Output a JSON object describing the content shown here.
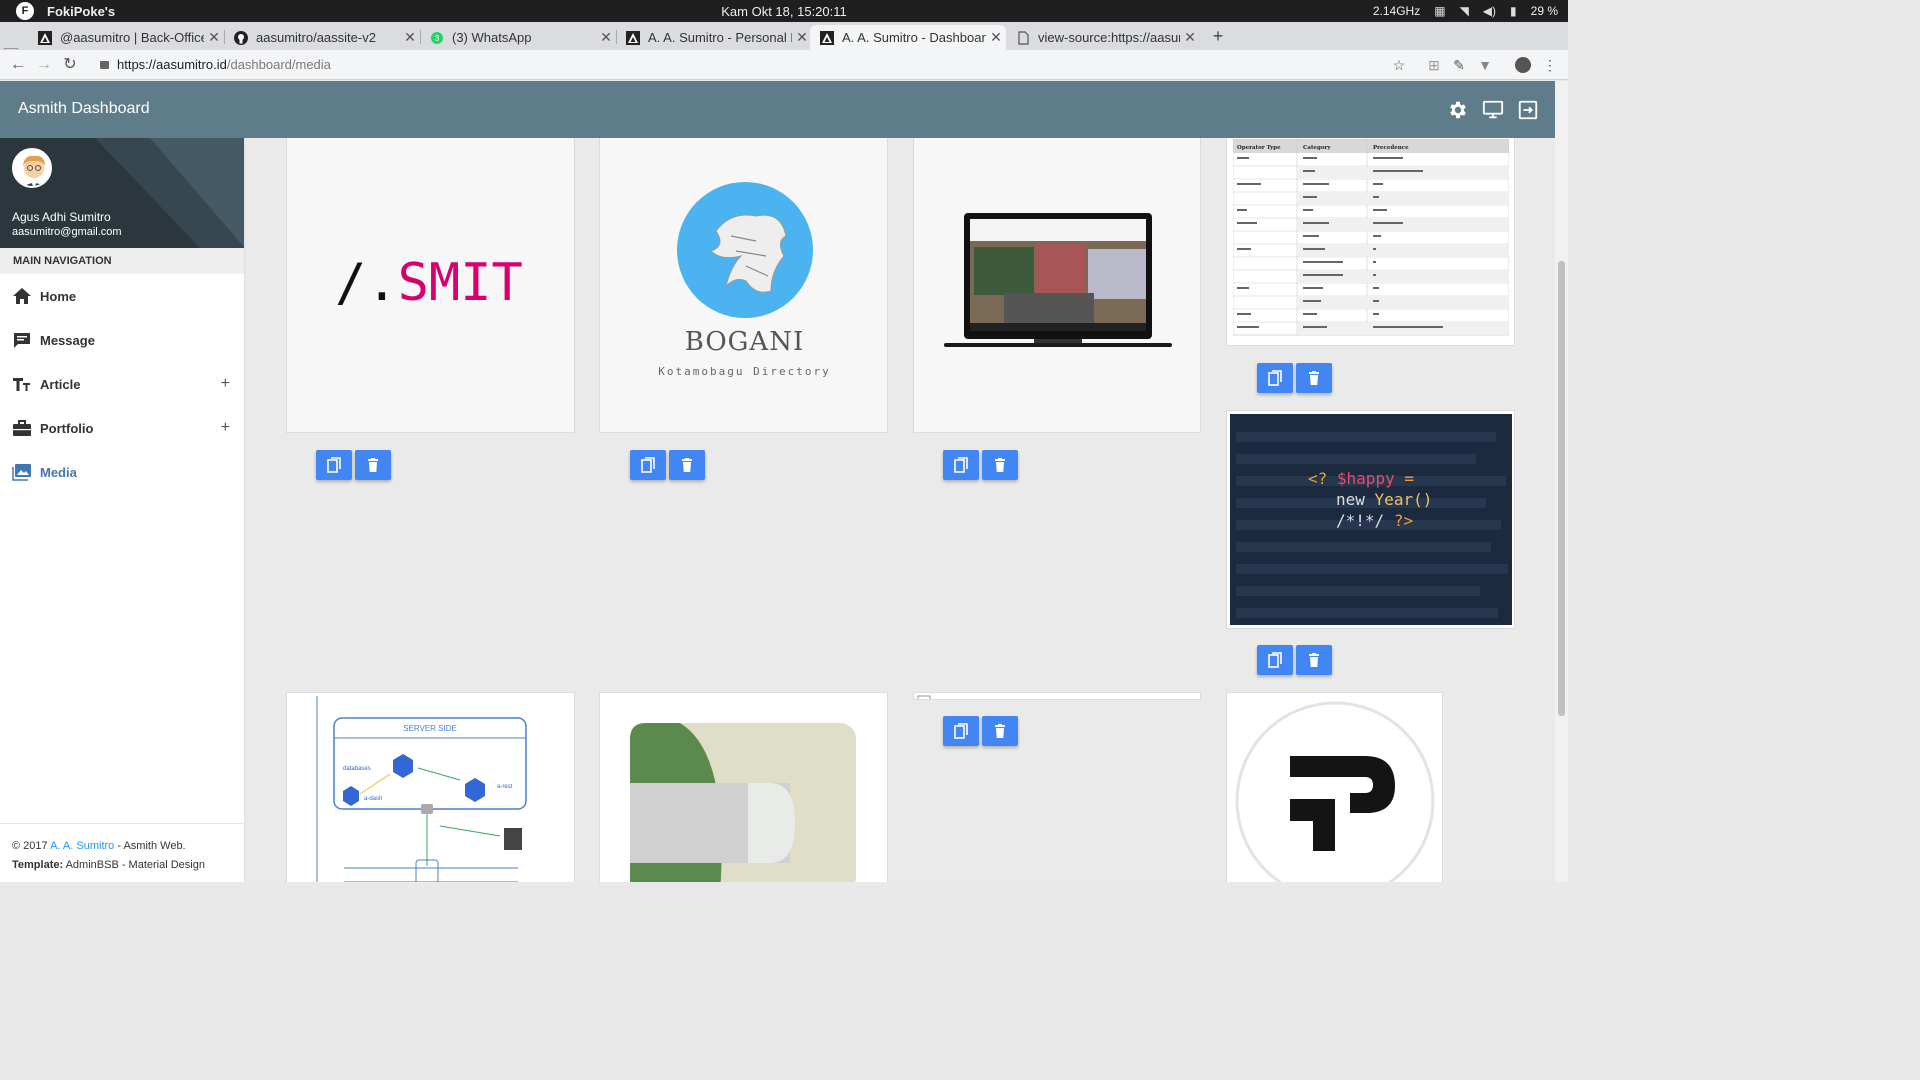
{
  "os": {
    "app_name": "FokiPoke's",
    "clock": "Kam Okt 18, 15:20:11",
    "cpu": "2.14GHz",
    "battery": "29 %"
  },
  "tabs": [
    {
      "title": "@aasumitro | Back-Office[",
      "icon": "triangle-logo-icon"
    },
    {
      "title": "aasumitro/aassite-v2",
      "icon": "github-icon"
    },
    {
      "title": "(3) WhatsApp",
      "icon": "whatsapp-icon"
    },
    {
      "title": "A. A. Sumitro - Personal Pa",
      "icon": "triangle-logo-icon"
    },
    {
      "title": "A. A. Sumitro - Dashboard",
      "icon": "triangle-logo-icon",
      "active": true
    },
    {
      "title": "view-source:https://aasumi",
      "icon": "page-icon"
    }
  ],
  "address": {
    "host": "https://aasumitro.id",
    "path": "/dashboard/media"
  },
  "header": {
    "title": "Asmith Dashboard"
  },
  "sidebar": {
    "user_name": "Agus Adhi Sumitro",
    "user_email": "aasumitro@gmail.com",
    "nav_header": "MAIN NAVIGATION",
    "items": [
      {
        "label": "Home",
        "icon": "home-icon"
      },
      {
        "label": "Message",
        "icon": "message-icon"
      },
      {
        "label": "Article",
        "icon": "text-icon",
        "expandable": "+"
      },
      {
        "label": "Portfolio",
        "icon": "briefcase-icon",
        "expandable": "+"
      },
      {
        "label": "Media",
        "icon": "image-icon",
        "active": true
      }
    ],
    "footer": {
      "copyright_prefix": "© 2017 ",
      "author": "A. A. Sumitro",
      "copyright_suffix": " - Asmith Web.",
      "template_label": "Template:",
      "template_name": " AdminBSB",
      "template_suffix": " - Material Design"
    }
  },
  "media": {
    "smit_text_a": "/.",
    "smit_text_b": "SMIT",
    "bogani_title": "BOGANI",
    "bogani_subtitle": "Kotamobagu Directory",
    "code_line1_a": "<?",
    "code_line1_b": "$happy",
    "code_line1_c": "=",
    "code_line2_a": "new",
    "code_line2_b": "Year()",
    "code_line3_a": "/*!*/",
    "code_line3_b": "?>",
    "server_side_label": "SERVER SIDE",
    "diagram_labels": [
      "databases",
      "a-dash",
      "a-rest"
    ],
    "table_headers": [
      "Operator Type",
      "Category",
      "Precedence"
    ]
  },
  "colors": {
    "header": "#5f7c8a",
    "accent_button": "#4286f4",
    "active_menu": "#3f77b5",
    "smit_pink": "#d6006e"
  }
}
